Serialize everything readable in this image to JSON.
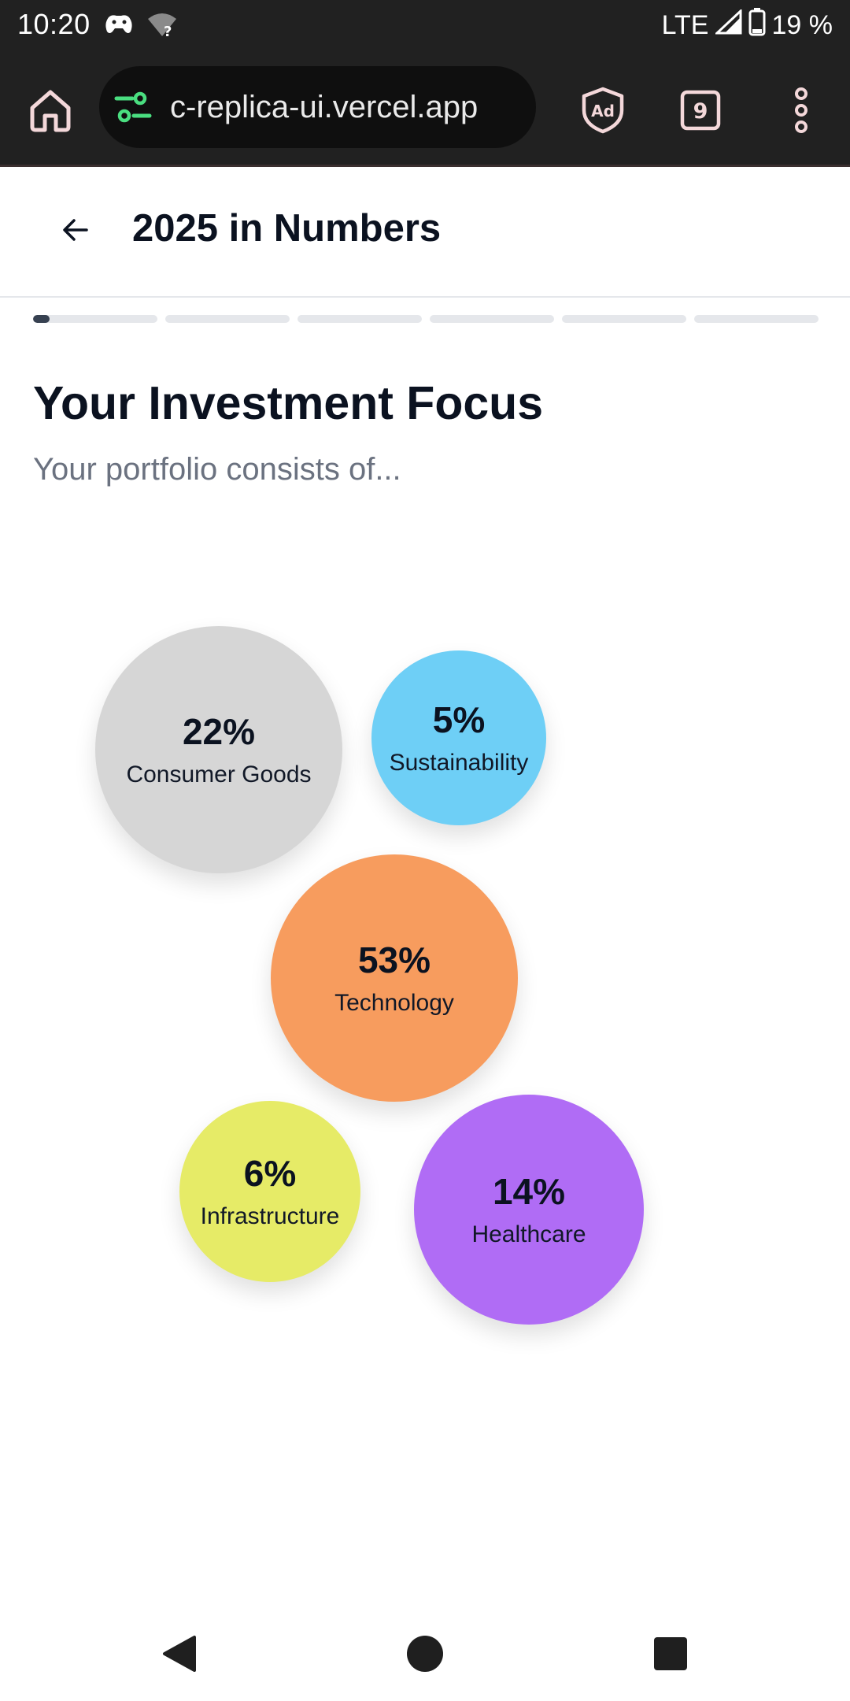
{
  "status": {
    "time": "10:20",
    "network": "LTE",
    "battery": "19 %"
  },
  "browser": {
    "url": "c-replica-ui.vercel.app",
    "tab_count": "9",
    "ad_label": "Ad"
  },
  "header": {
    "title": "2025 in Numbers"
  },
  "progress": {
    "segments": 6,
    "current_index": 0,
    "current_fill": 0.13
  },
  "section": {
    "title": "Your Investment Focus",
    "subtitle": "Your portfolio consists of..."
  },
  "bubbles": [
    {
      "percent": "22%",
      "label": "Consumer Goods",
      "color": "#d6d6d6"
    },
    {
      "percent": "5%",
      "label": "Sustainability",
      "color": "#6ecff6"
    },
    {
      "percent": "53%",
      "label": "Technology",
      "color": "#f79c5e"
    },
    {
      "percent": "6%",
      "label": "Infrastructure",
      "color": "#e6eb67"
    },
    {
      "percent": "14%",
      "label": "Healthcare",
      "color": "#b06cf5"
    }
  ]
}
